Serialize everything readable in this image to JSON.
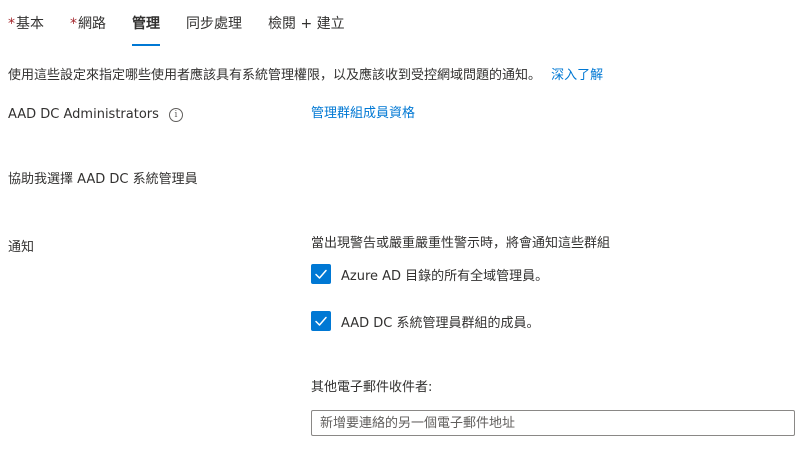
{
  "tabs": [
    {
      "label": "基本",
      "required": true,
      "active": false
    },
    {
      "label": "網路",
      "required": true,
      "active": false
    },
    {
      "label": "管理",
      "required": false,
      "active": true
    },
    {
      "label": "同步處理",
      "required": false,
      "active": false
    },
    {
      "label": "檢閱 + 建立",
      "required": false,
      "active": false
    }
  ],
  "required_marker": "*",
  "description": {
    "text": "使用這些設定來指定哪些使用者應該具有系統管理權限，以及應該收到受控網域問題的通知。",
    "learn_more": "深入了解"
  },
  "admins": {
    "label": "AAD DC Administrators",
    "info_icon": "info-icon",
    "manage_link": "管理群組成員資格"
  },
  "help_link": "協助我選擇 AAD DC 系統管理員",
  "notifications": {
    "label": "通知",
    "description": "當出現警告或嚴重嚴重性警示時，將會通知這些群組",
    "options": [
      {
        "label": "Azure AD 目錄的所有全域管理員。",
        "checked": true
      },
      {
        "label": "AAD DC 系統管理員群組的成員。",
        "checked": true
      }
    ],
    "other_recipients_label": "其他電子郵件收件者:",
    "email_placeholder": "新增要連絡的另一個電子郵件地址",
    "email_value": ""
  },
  "colors": {
    "accent": "#0078d4",
    "required": "#a4262c",
    "text": "#323130"
  }
}
